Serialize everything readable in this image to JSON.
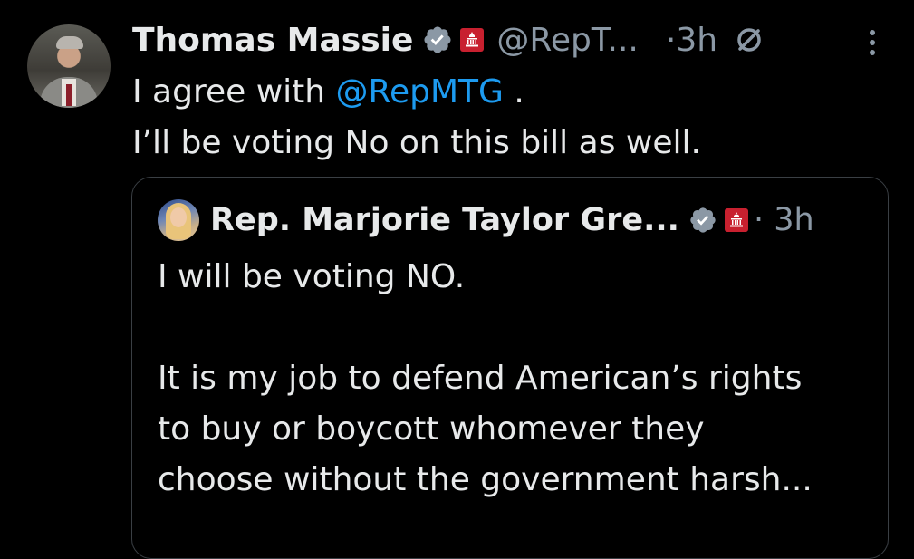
{
  "tweet": {
    "author_name": "Thomas Massie",
    "handle": "@RepT...",
    "time": "·3h",
    "line1_prefix": "I agree with ",
    "mention": "@RepMTG",
    "line1_suffix": " .",
    "line2": "I’ll be voting No on this bill as well."
  },
  "quote": {
    "author_name": "Rep. Marjorie Taylor Gre...",
    "time": "· 3h",
    "line1": "I will be voting NO.",
    "line2": "",
    "line3": "It is my job to defend American’s rights",
    "line4": "to buy or boycott whomever they",
    "line5": "choose without the government harsh..."
  },
  "icons": {
    "verified": "verified-badge-icon",
    "affiliation": "capitol-affiliation-icon",
    "reply_restricted": "reply-restricted-icon",
    "more": "more-options-icon"
  },
  "colors": {
    "background": "#000000",
    "text": "#e7e9ea",
    "secondary": "#8b98a5",
    "link": "#1d9bf0",
    "badge": "#8b98a5",
    "affiliation": "#c8202f"
  }
}
